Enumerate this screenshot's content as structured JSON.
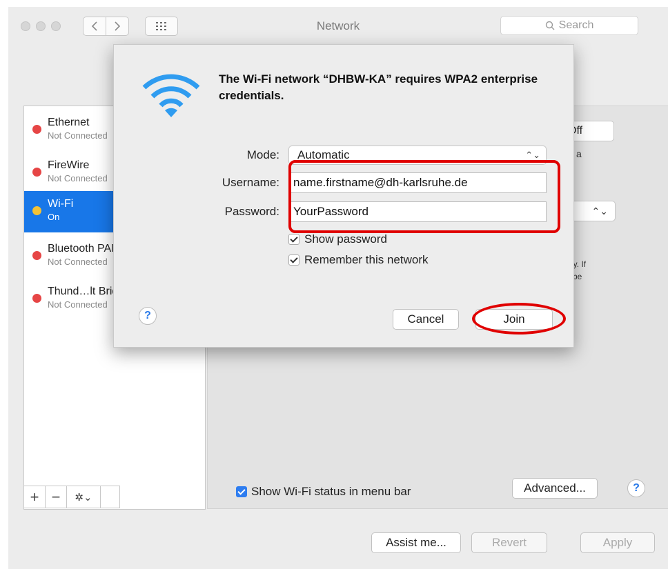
{
  "window": {
    "title": "Network",
    "search_placeholder": "Search"
  },
  "services": [
    {
      "name": "Ethernet",
      "status": "Not Connected",
      "dot": "red"
    },
    {
      "name": "FireWire",
      "status": "Not Connected",
      "dot": "red"
    },
    {
      "name": "Wi-Fi",
      "status": "On",
      "dot": "yellow",
      "selected": true
    },
    {
      "name": "Bluetooth PAN",
      "status": "Not Connected",
      "dot": "red"
    },
    {
      "name": "Thund…lt Bridge",
      "status": "Not Connected",
      "dot": "red"
    }
  ],
  "sidebar_controls": {
    "add": "+",
    "remove": "−",
    "gear": "✲⌄"
  },
  "pane": {
    "wifi_off_label": "i Off",
    "text_connected": "ed to a",
    "text_auto1": "atically. If",
    "text_auto2": "u will be",
    "show_wifi_status": "Show Wi-Fi status in menu bar",
    "show_wifi_status_checked": true,
    "advanced_label": "Advanced...",
    "help": "?"
  },
  "footer": {
    "assist_label": "Assist me...",
    "revert_label": "Revert",
    "apply_label": "Apply"
  },
  "dialog": {
    "title": "The Wi-Fi network “DHBW-KA” requires WPA2 enterprise credentials.",
    "mode_label": "Mode:",
    "mode_value": "Automatic",
    "username_label": "Username:",
    "username_value": "name.firstname@dh-karlsruhe.de",
    "password_label": "Password:",
    "password_value": "YourPassword",
    "show_password": "Show password",
    "show_password_checked": true,
    "remember_network": "Remember this network",
    "remember_network_checked": true,
    "cancel_label": "Cancel",
    "join_label": "Join",
    "help": "?"
  },
  "colors": {
    "selection_blue": "#1877e8",
    "highlight_red": "#e00000",
    "wifi_icon_blue": "#2f9cf0",
    "status_red": "#e64545",
    "status_yellow": "#f3c235"
  }
}
